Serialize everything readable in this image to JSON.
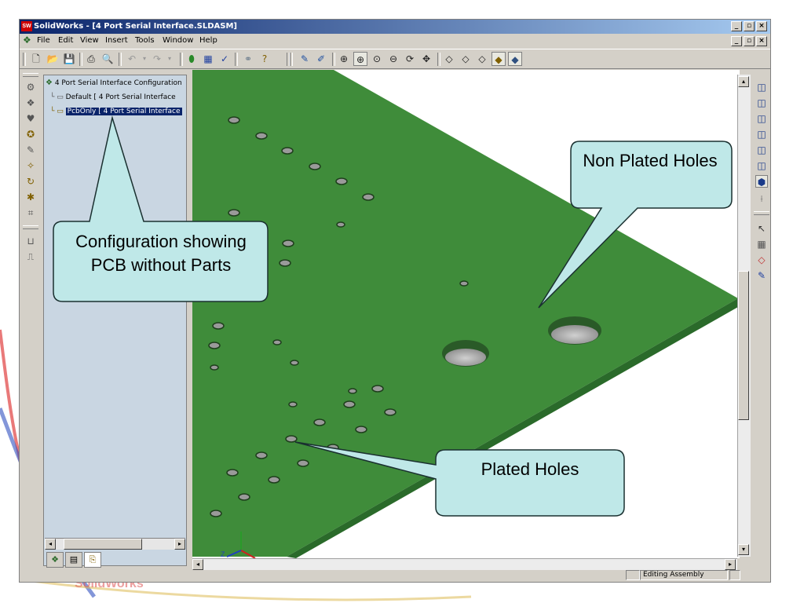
{
  "window": {
    "title": "SolidWorks - [4 Port Serial Interface.SLDASM]",
    "logo_text": "SW",
    "caption_buttons": [
      "_",
      "▫",
      "×"
    ]
  },
  "menu": {
    "items": [
      "File",
      "Edit",
      "View",
      "Insert",
      "Tools",
      "Window",
      "Help"
    ]
  },
  "tree": {
    "root": "4 Port Serial Interface Configuration",
    "configs": [
      {
        "label": "Default [ 4 Port Serial Interface",
        "selected": false
      },
      {
        "label": "PcbOnly [ 4 Port Serial Interface",
        "selected": true
      }
    ]
  },
  "status": {
    "mode": "Editing Assembly"
  },
  "callouts": {
    "config": "Configuration showing PCB without Parts",
    "non_plated": "Non Plated Holes",
    "plated": "Plated Holes"
  },
  "colors": {
    "pcb_green": "#3f8c3a",
    "callout_fill": "#bfe8e8",
    "title_blue": "#0a246a"
  }
}
